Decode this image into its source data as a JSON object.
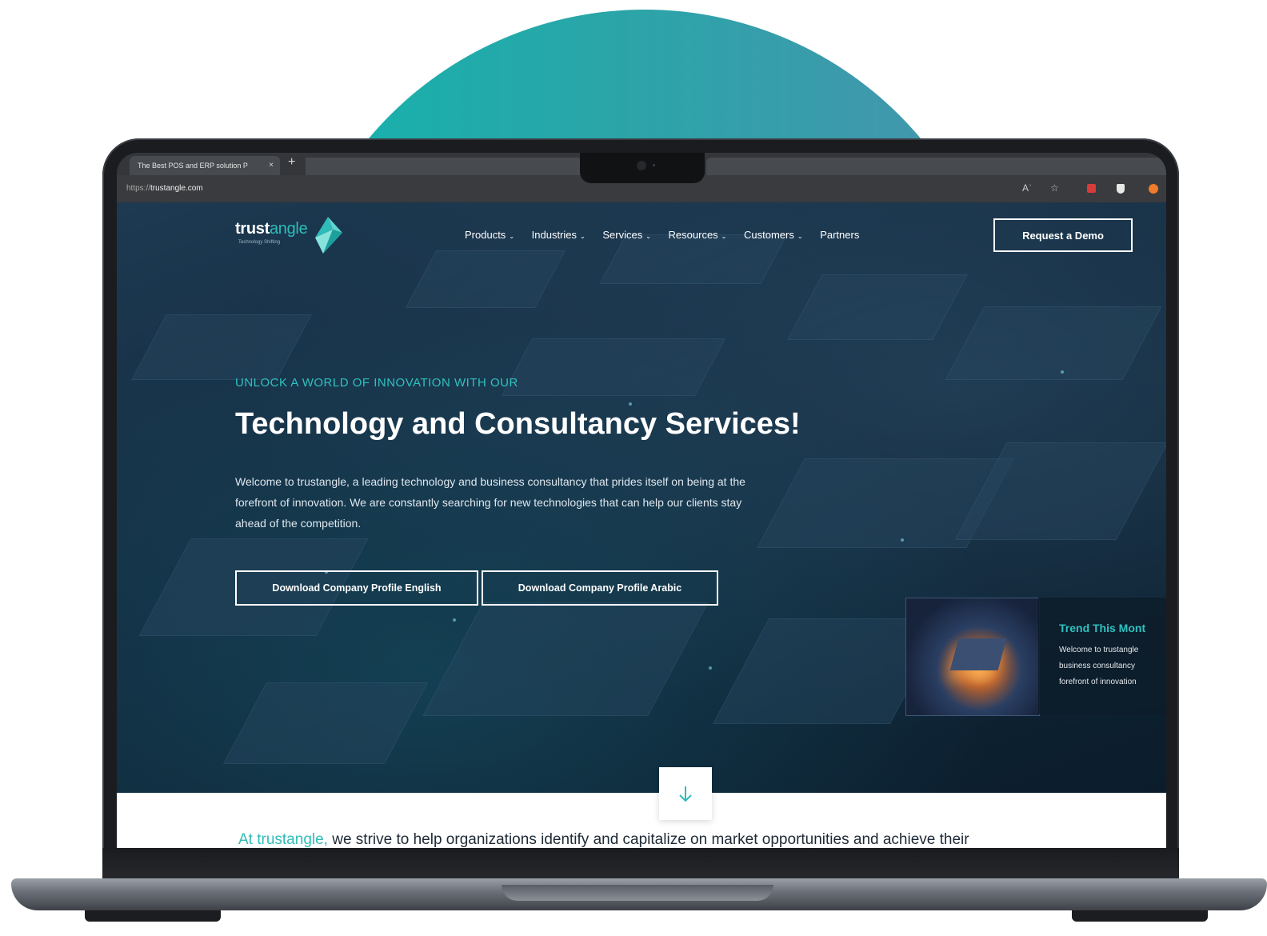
{
  "browser": {
    "tab_title": "The Best POS and ERP solution P",
    "tab_close": "×",
    "new_tab": "+",
    "url_prefix": "https://",
    "url_domain": "trustangle.com",
    "toolbar_read_aloud": "Aʾ",
    "toolbar_favorite": "☆"
  },
  "site": {
    "logo_main": "trust",
    "logo_accent": "angle",
    "logo_tagline": "Technology Shifting",
    "nav": [
      {
        "label": "Products",
        "chevron": "⌄"
      },
      {
        "label": "Industries",
        "chevron": "⌄"
      },
      {
        "label": "Services",
        "chevron": "⌄"
      },
      {
        "label": "Resources",
        "chevron": "⌄"
      },
      {
        "label": "Customers",
        "chevron": "⌄"
      },
      {
        "label": "Partners"
      }
    ],
    "cta_label": "Request a Demo"
  },
  "hero": {
    "eyebrow": "UNLOCK A WORLD OF INNOVATION WITH OUR",
    "headline": "Technology and Consultancy Services!",
    "body": "Welcome to trustangle, a leading technology and business consultancy that prides itself on being at the forefront of innovation. We are constantly searching for new technologies that can help our clients stay ahead of the competition.",
    "btn_english": "Download Company Profile English",
    "btn_arabic": "Download Company Profile Arabic"
  },
  "trend": {
    "title": "Trend This Mont",
    "line1": "Welcome to trustangle",
    "line2": "business consultancy",
    "line3": "forefront of innovation"
  },
  "intro": {
    "brand": "At trustangle,",
    "text": " we strive to help organizations identify and capitalize on market opportunities and achieve their"
  },
  "colors": {
    "accent": "#2fbcb8",
    "circle_start": "#14b3ad",
    "circle_end": "#4794ae",
    "hero_dark": "#0b1d2c"
  }
}
